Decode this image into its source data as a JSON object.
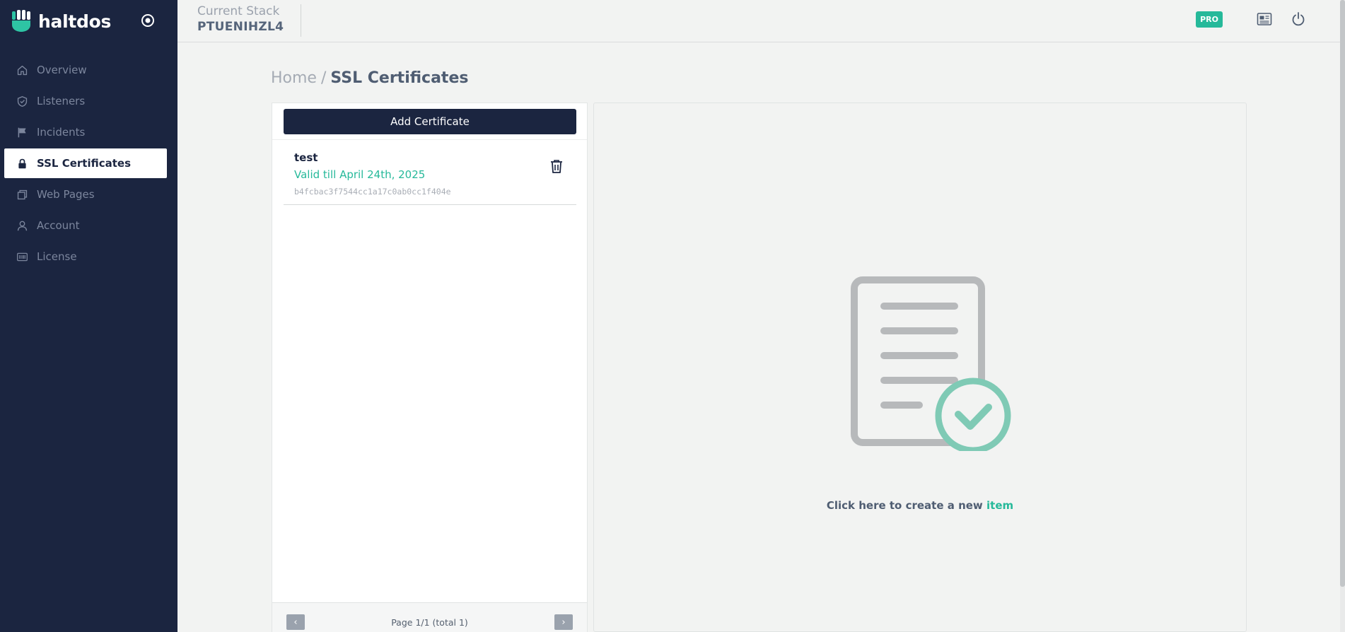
{
  "app": {
    "name": "haltdos"
  },
  "sidebar": {
    "items": [
      {
        "label": "Overview",
        "icon": "home-icon",
        "active": false
      },
      {
        "label": "Listeners",
        "icon": "shield-check-icon",
        "active": false
      },
      {
        "label": "Incidents",
        "icon": "flag-icon",
        "active": false
      },
      {
        "label": "SSL Certificates",
        "icon": "lock-icon",
        "active": true
      },
      {
        "label": "Web Pages",
        "icon": "windows-icon",
        "active": false
      },
      {
        "label": "Account",
        "icon": "user-icon",
        "active": false
      },
      {
        "label": "License",
        "icon": "barcode-icon",
        "active": false
      }
    ]
  },
  "topbar": {
    "stack_label": "Current Stack",
    "stack_value": "PTUENIHZL4",
    "badge": "PRO"
  },
  "breadcrumb": {
    "home": "Home",
    "separator": "/",
    "current": "SSL Certificates"
  },
  "list": {
    "add_label": "Add Certificate",
    "items": [
      {
        "name": "test",
        "valid": "Valid till April 24th, 2025",
        "hash": "b4fcbac3f7544cc1a17c0ab0cc1f404e"
      }
    ],
    "pager": {
      "prev": "‹",
      "next": "›",
      "text": "Page 1/1 (total 1)"
    }
  },
  "detail": {
    "prompt": "Click here to create a new ",
    "link": "item"
  },
  "colors": {
    "sidebar": "#1b2540",
    "accent": "#26b99a",
    "background": "#f2f3f2"
  }
}
